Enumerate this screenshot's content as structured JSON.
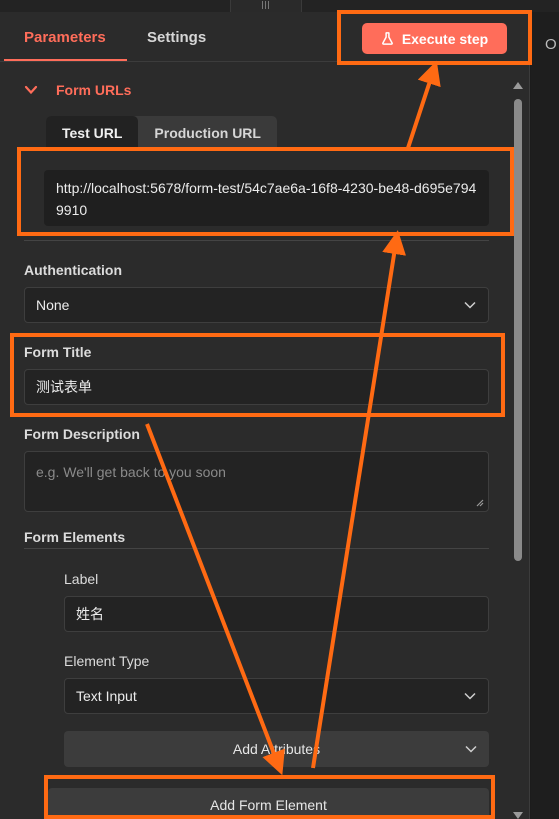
{
  "tabs": {
    "parameters": "Parameters",
    "settings": "Settings"
  },
  "execute_label": "Execute step",
  "partial_right_text": "O",
  "form_urls": {
    "heading": "Form URLs",
    "test_tab": "Test URL",
    "production_tab": "Production URL",
    "url": "http://localhost:5678/form-test/54c7ae6a-16f8-4230-be48-d695e7949910"
  },
  "authentication": {
    "label": "Authentication",
    "value": "None"
  },
  "form_title": {
    "label": "Form Title",
    "value": "测试表单"
  },
  "form_description": {
    "label": "Form Description",
    "placeholder": "e.g. We'll get back to you soon"
  },
  "form_elements": {
    "label": "Form Elements",
    "element_label_caption": "Label",
    "element_label_value": "姓名",
    "element_type_caption": "Element Type",
    "element_type_value": "Text Input",
    "add_attributes": "Add Attributes",
    "add_element": "Add Form Element"
  },
  "colors": {
    "accent": "#ff6d5a",
    "annotation": "#ff6a13"
  }
}
